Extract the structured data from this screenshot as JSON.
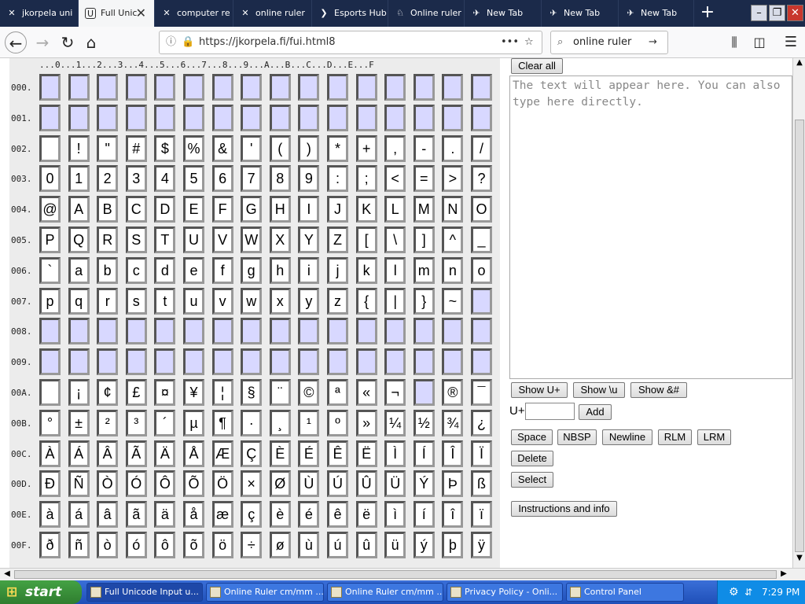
{
  "browser": {
    "tabs": [
      {
        "label": "jkorpela uni",
        "icon": "✕"
      },
      {
        "label": "Full Unic",
        "icon": "U"
      },
      {
        "label": "computer re",
        "icon": "✕"
      },
      {
        "label": "online ruler",
        "icon": "✕"
      },
      {
        "label": "Esports Hub",
        "icon": "❯"
      },
      {
        "label": "Online ruler",
        "icon": "♘"
      },
      {
        "label": "New Tab",
        "icon": "✈"
      },
      {
        "label": "New Tab",
        "icon": "✈"
      },
      {
        "label": "New Tab",
        "icon": "✈"
      }
    ],
    "new_tab": "+",
    "url": "https://jkorpela.fi/fui.html8",
    "url_more": "•••",
    "search_text": "online ruler"
  },
  "ruler_text": "...0...1...2...3...4...5...6...7...8...9...A...B...C...D...E...F",
  "row_labels": [
    "000.",
    "001.",
    "002.",
    "003.",
    "004.",
    "005.",
    "006.",
    "007.",
    "008.",
    "009.",
    "00A.",
    "00B.",
    "00C.",
    "00D.",
    "00E.",
    "00F."
  ],
  "grid_rows": [
    [
      "",
      "",
      "",
      "",
      "",
      "",
      "",
      "",
      "",
      "",
      "",
      "",
      "",
      "",
      "",
      ""
    ],
    [
      "",
      "",
      "",
      "",
      "",
      "",
      "",
      "",
      "",
      "",
      "",
      "",
      "",
      "",
      "",
      ""
    ],
    [
      "",
      " !",
      "\"",
      "#",
      "$",
      "%",
      "&",
      "'",
      "(",
      ")",
      "*",
      "+",
      ",",
      "-",
      ".",
      "/"
    ],
    [
      "0",
      "1",
      "2",
      "3",
      "4",
      "5",
      "6",
      "7",
      "8",
      "9",
      ":",
      ";",
      "<",
      "=",
      ">",
      "?"
    ],
    [
      "@",
      "A",
      "B",
      "C",
      "D",
      "E",
      "F",
      "G",
      "H",
      "I",
      "J",
      "K",
      "L",
      "M",
      "N",
      "O"
    ],
    [
      "P",
      "Q",
      "R",
      "S",
      "T",
      "U",
      "V",
      "W",
      "X",
      "Y",
      "Z",
      "[",
      "\\",
      "]",
      "^",
      "_"
    ],
    [
      "`",
      "a",
      "b",
      "c",
      "d",
      "e",
      "f",
      "g",
      "h",
      "i",
      "j",
      "k",
      "l",
      "m",
      "n",
      "o"
    ],
    [
      "p",
      "q",
      "r",
      "s",
      "t",
      "u",
      "v",
      "w",
      "x",
      "y",
      "z",
      "{",
      "|",
      "}",
      "~",
      ""
    ],
    [
      "",
      "",
      "",
      "",
      "",
      "",
      "",
      "",
      "",
      "",
      "",
      "",
      "",
      "",
      "",
      ""
    ],
    [
      "",
      "",
      "",
      "",
      "",
      "",
      "",
      "",
      "",
      "",
      "",
      "",
      "",
      "",
      "",
      ""
    ],
    [
      "",
      "¡",
      "¢",
      "£",
      "¤",
      "¥",
      "¦",
      "§",
      "¨",
      "©",
      "ª",
      "«",
      "¬",
      "",
      "®",
      "¯"
    ],
    [
      "°",
      "±",
      "²",
      "³",
      "´",
      "µ",
      "¶",
      "·",
      "¸",
      "¹",
      "º",
      "»",
      "¼",
      "½",
      "¾",
      "¿"
    ],
    [
      "À",
      "Á",
      "Â",
      "Ã",
      "Ä",
      "Å",
      "Æ",
      "Ç",
      "È",
      "É",
      "Ê",
      "Ë",
      "Ì",
      "Í",
      "Î",
      "Ï"
    ],
    [
      "Ð",
      "Ñ",
      "Ò",
      "Ó",
      "Ô",
      "Õ",
      "Ö",
      "×",
      "Ø",
      "Ù",
      "Ú",
      "Û",
      "Ü",
      "Ý",
      "Þ",
      "ß"
    ],
    [
      "à",
      "á",
      "â",
      "ã",
      "ä",
      "å",
      "æ",
      "ç",
      "è",
      "é",
      "ê",
      "ë",
      "ì",
      "í",
      "î",
      "ï"
    ],
    [
      "ð",
      "ñ",
      "ò",
      "ó",
      "ô",
      "õ",
      "ö",
      "÷",
      "ø",
      "ù",
      "ú",
      "û",
      "ü",
      "ý",
      "þ",
      "ÿ"
    ]
  ],
  "panel": {
    "clear_all": "Clear all",
    "textarea_placeholder": "The text will appear here. You can also type here directly.",
    "show_uplus": "Show U+",
    "show_backslash_u": "Show \\u",
    "show_entity": "Show &#",
    "uplus_label": "U+",
    "add": "Add",
    "space": "Space",
    "nbsp": "NBSP",
    "newline": "Newline",
    "rlm": "RLM",
    "lrm": "LRM",
    "delete": "Delete",
    "select": "Select",
    "instructions": "Instructions and info"
  },
  "taskbar": {
    "start": "start",
    "tasks": [
      "Full Unicode Input u...",
      "Online Ruler cm/mm ...",
      "Online Ruler cm/mm ...",
      "Privacy Policy - Onli...",
      "Control Panel"
    ],
    "time": "7:29 PM"
  }
}
